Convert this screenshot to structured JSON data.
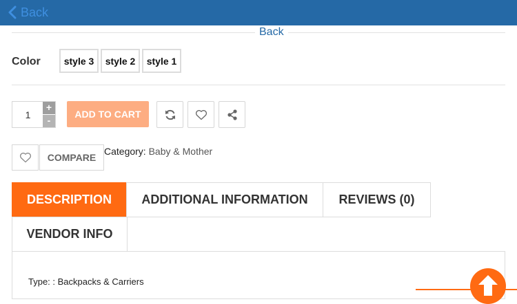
{
  "topbar": {
    "back_label": "Back",
    "color": "#2569a6"
  },
  "content": {
    "back_label": "Back",
    "color_label": "Color",
    "color_options": [
      "style 3",
      "style 2",
      "style 1"
    ],
    "quantity_value": "1",
    "qty_plus": "+",
    "qty_minus": "-",
    "add_to_cart_label": "ADD TO CART",
    "compare_label": "COMPARE",
    "category_prefix": "Category:",
    "category_value": "Baby & Mother",
    "accent_color": "#ff6a12"
  },
  "tabs": [
    {
      "label": "DESCRIPTION",
      "active": true
    },
    {
      "label": "ADDITIONAL INFORMATION",
      "active": false
    },
    {
      "label": "REVIEWS (0)",
      "active": false
    },
    {
      "label": "VENDOR INFO",
      "active": false
    }
  ],
  "description": {
    "type_line": "Type: : Backpacks & Carriers"
  },
  "icons": {
    "topbar_back": "chevron-left-icon",
    "refresh": "refresh-icon",
    "wishlist": "heart-icon",
    "share": "share-icon",
    "scroll_top": "arrow-up-icon"
  }
}
